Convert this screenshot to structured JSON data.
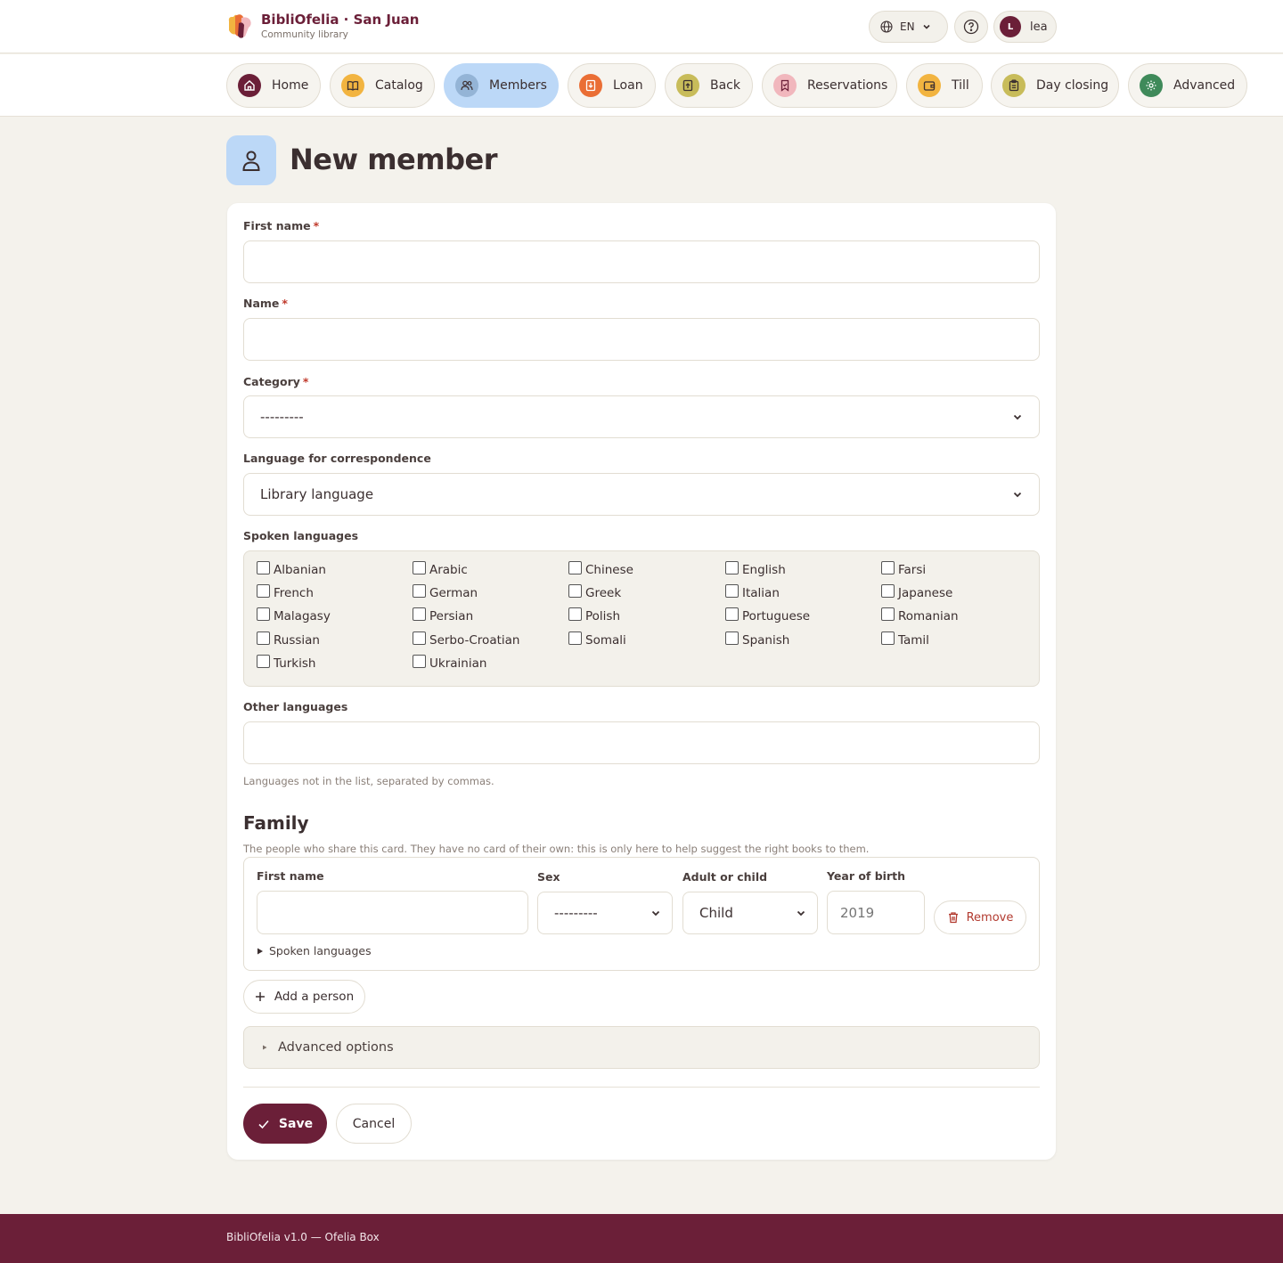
{
  "brand": {
    "title": "BibliOfelia · San Juan",
    "subtitle": "Community library"
  },
  "header": {
    "language": "EN",
    "user_initial": "L",
    "user_name": "lea"
  },
  "nav": [
    {
      "label": "Home",
      "icon": "home-icon",
      "color": "#6b1f38",
      "active": false
    },
    {
      "label": "Catalog",
      "icon": "book-icon",
      "color": "#f2b440",
      "active": false
    },
    {
      "label": "Members",
      "icon": "users-icon",
      "color": "#94b4d6",
      "active": true
    },
    {
      "label": "Loan",
      "icon": "loan-icon",
      "color": "#ea6e35",
      "active": false
    },
    {
      "label": "Back",
      "icon": "return-icon",
      "color": "#c8bc5a",
      "active": false
    },
    {
      "label": "Reservations",
      "icon": "bookmark-icon",
      "color": "#f1b7bd",
      "active": false
    },
    {
      "label": "Till",
      "icon": "wallet-icon",
      "color": "#f2b440",
      "active": false
    },
    {
      "label": "Day closing",
      "icon": "clipboard-icon",
      "color": "#c8bc5a",
      "active": false
    },
    {
      "label": "Advanced",
      "icon": "gear-icon",
      "color": "#3f8a5a",
      "active": false
    }
  ],
  "page": {
    "title": "New member",
    "icon": "user-icon"
  },
  "form": {
    "first_name": {
      "label": "First name",
      "required": "*",
      "value": ""
    },
    "name": {
      "label": "Name",
      "required": "*",
      "value": ""
    },
    "category": {
      "label": "Category",
      "required": "*",
      "selected": "---------"
    },
    "correspondence_language": {
      "label": "Language for correspondence",
      "selected": "Library language"
    },
    "spoken_languages": {
      "label": "Spoken languages",
      "options": [
        "Albanian",
        "Arabic",
        "Chinese",
        "English",
        "Farsi",
        "French",
        "German",
        "Greek",
        "Italian",
        "Japanese",
        "Malagasy",
        "Persian",
        "Polish",
        "Portuguese",
        "Romanian",
        "Russian",
        "Serbo-Croatian",
        "Somali",
        "Spanish",
        "Tamil",
        "Turkish",
        "Ukrainian"
      ]
    },
    "other_languages": {
      "label": "Other languages",
      "value": "",
      "help": "Languages not in the list, separated by commas."
    }
  },
  "family": {
    "title": "Family",
    "description": "The people who share this card. They have no card of their own: this is only here to help suggest the right books to them.",
    "columns": {
      "first_name": "First name",
      "sex": "Sex",
      "age_group": "Adult or child",
      "year_of_birth": "Year of birth"
    },
    "row": {
      "first_name": "",
      "sex": "---------",
      "age_group": "Child",
      "year_placeholder": "2019",
      "remove": "Remove",
      "spoken_languages": "Spoken languages"
    },
    "add_person": "Add a person"
  },
  "advanced_options": "Advanced options",
  "actions": {
    "save": "Save",
    "cancel": "Cancel"
  },
  "footer": "BibliOfelia v1.0 — Ofelia Box"
}
